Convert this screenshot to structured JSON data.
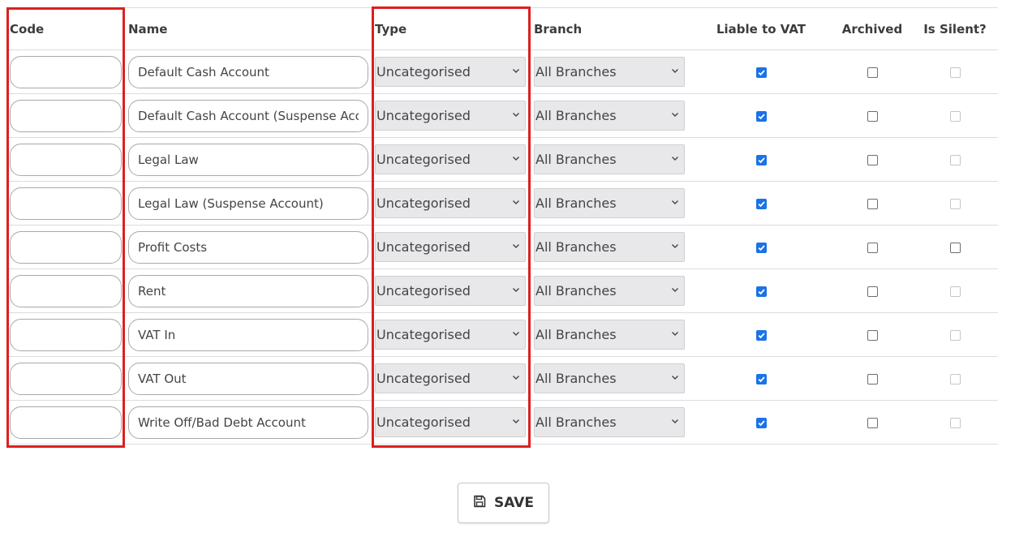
{
  "table": {
    "headers": {
      "code": "Code",
      "name": "Name",
      "type": "Type",
      "branch": "Branch",
      "liable_to_vat": "Liable to VAT",
      "archived": "Archived",
      "is_silent": "Is Silent?"
    },
    "rows": [
      {
        "code": "",
        "name": "Default Cash Account",
        "type": "Uncategorised",
        "branch": "All Branches",
        "liable_to_vat": true,
        "archived": false,
        "is_silent": false,
        "silent_enabled": false
      },
      {
        "code": "",
        "name": "Default Cash Account (Suspense Account)",
        "type": "Uncategorised",
        "branch": "All Branches",
        "liable_to_vat": true,
        "archived": false,
        "is_silent": false,
        "silent_enabled": false
      },
      {
        "code": "",
        "name": "Legal Law",
        "type": "Uncategorised",
        "branch": "All Branches",
        "liable_to_vat": true,
        "archived": false,
        "is_silent": false,
        "silent_enabled": false
      },
      {
        "code": "",
        "name": "Legal Law (Suspense Account)",
        "type": "Uncategorised",
        "branch": "All Branches",
        "liable_to_vat": true,
        "archived": false,
        "is_silent": false,
        "silent_enabled": false
      },
      {
        "code": "",
        "name": "Profit Costs",
        "type": "Uncategorised",
        "branch": "All Branches",
        "liable_to_vat": true,
        "archived": false,
        "is_silent": false,
        "silent_enabled": true
      },
      {
        "code": "",
        "name": "Rent",
        "type": "Uncategorised",
        "branch": "All Branches",
        "liable_to_vat": true,
        "archived": false,
        "is_silent": false,
        "silent_enabled": false
      },
      {
        "code": "",
        "name": "VAT In",
        "type": "Uncategorised",
        "branch": "All Branches",
        "liable_to_vat": true,
        "archived": false,
        "is_silent": false,
        "silent_enabled": false
      },
      {
        "code": "",
        "name": "VAT Out",
        "type": "Uncategorised",
        "branch": "All Branches",
        "liable_to_vat": true,
        "archived": false,
        "is_silent": false,
        "silent_enabled": false
      },
      {
        "code": "",
        "name": "Write Off/Bad Debt Account",
        "type": "Uncategorised",
        "branch": "All Branches",
        "liable_to_vat": true,
        "archived": false,
        "is_silent": false,
        "silent_enabled": false
      }
    ]
  },
  "save_button": {
    "label": "SAVE",
    "icon": "floppy-disk-icon"
  },
  "colors": {
    "highlight": "#dd1f1f",
    "checkbox_checked": "#1a73e8",
    "select_bg": "#e8e8eb",
    "row_border": "#dcdcdc"
  }
}
